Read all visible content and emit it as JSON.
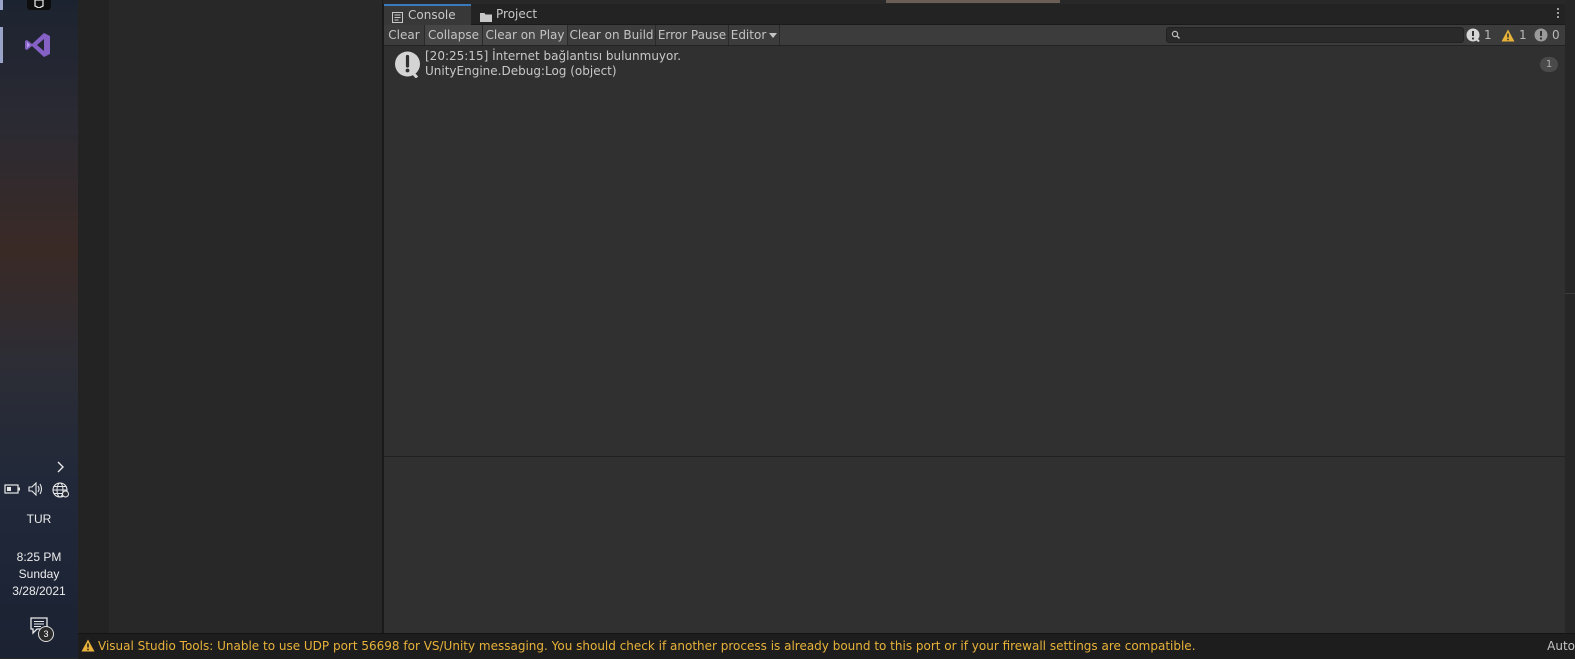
{
  "taskbar": {
    "language": "TUR",
    "time": "8:25 PM",
    "day": "Sunday",
    "date": "3/28/2021",
    "notification_count": "3"
  },
  "console": {
    "tabs": [
      {
        "label": "Console",
        "icon": "console-icon",
        "active": true
      },
      {
        "label": "Project",
        "icon": "folder-icon",
        "active": false
      }
    ],
    "toolbar": {
      "clear": "Clear",
      "collapse": "Collapse",
      "clear_on_play": "Clear on Play",
      "clear_on_build": "Clear on Build",
      "error_pause": "Error Pause",
      "editor": "Editor",
      "search_placeholder": "",
      "log_count": "1",
      "warning_count": "1",
      "error_count": "0"
    },
    "entries": [
      {
        "line1": "[20:25:15] İnternet bağlantısı bulunmuyor.",
        "line2": "UnityEngine.Debug:Log (object)",
        "count": "1",
        "icon": "info-icon"
      }
    ]
  },
  "status_bar": {
    "message": "Visual Studio Tools: Unable to use UDP port 56698 for VS/Unity messaging. You should check if another process is already bound to this port or if your firewall settings are compatible.",
    "right_text": "Auto"
  },
  "colors": {
    "warning_text": "#e8b23a",
    "active_tab_accent": "#3a79bb",
    "vs_purple": "#8661c5"
  }
}
